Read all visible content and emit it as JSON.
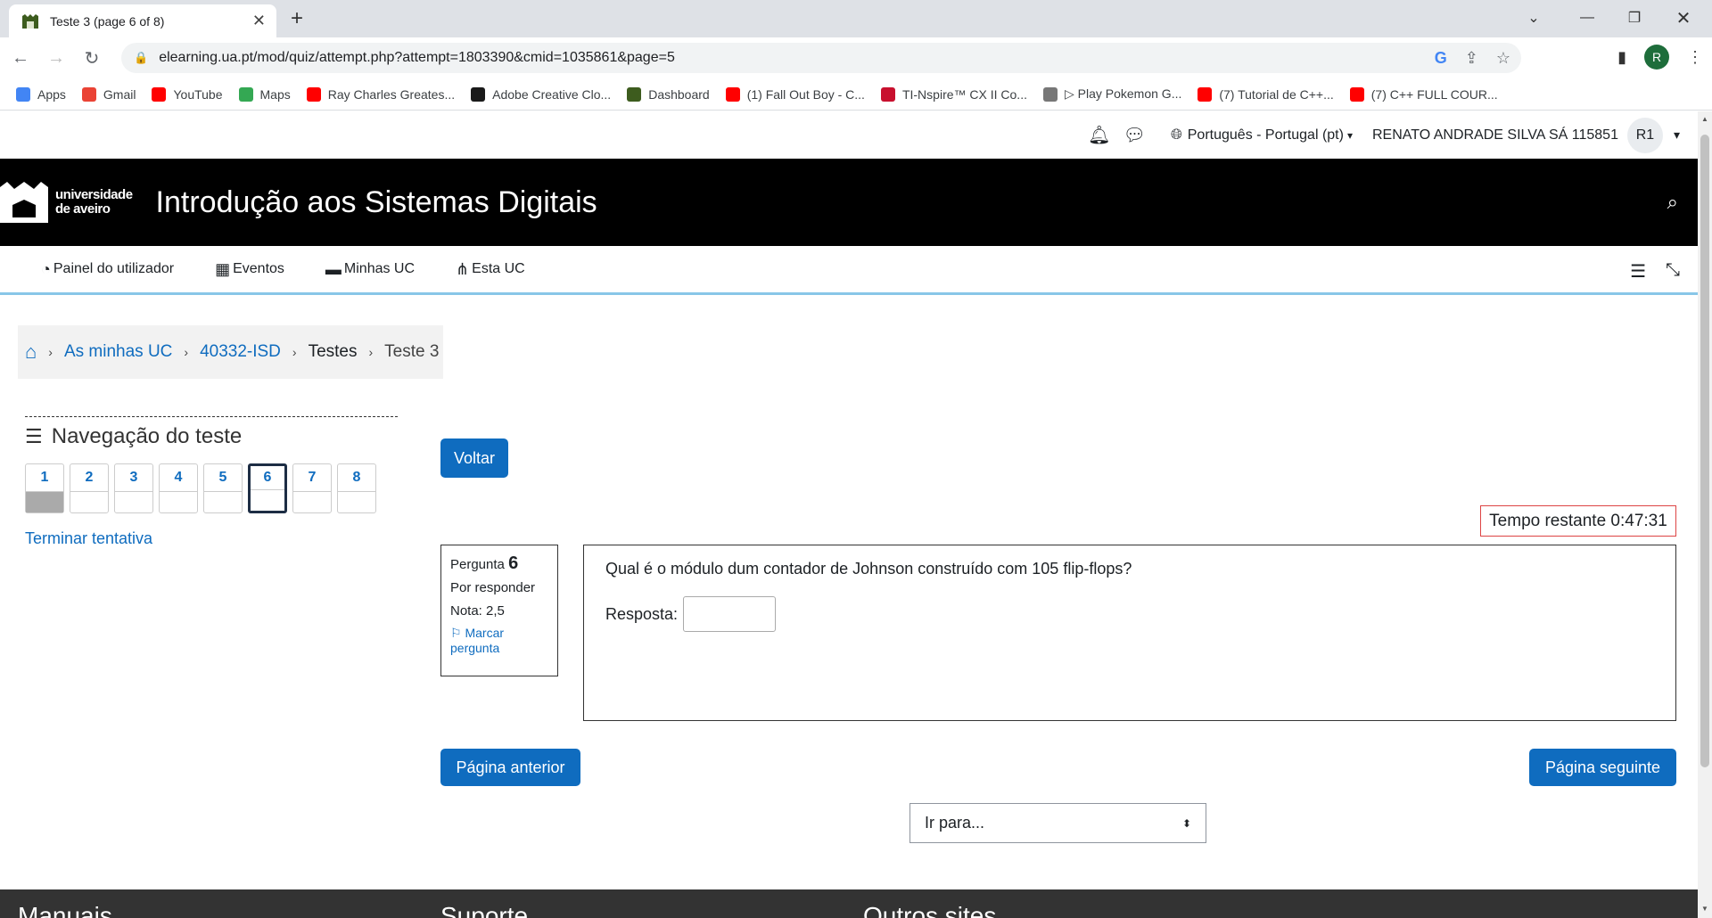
{
  "browser": {
    "tab_title": "Teste 3 (page 6 of 8)",
    "url": "elearning.ua.pt/mod/quiz/attempt.php?attempt=1803390&cmid=1035861&page=5",
    "profile_initial": "R",
    "bookmarks": [
      {
        "label": "Apps",
        "icon": "apps-grid-icon",
        "color": "#4285f4"
      },
      {
        "label": "Gmail",
        "icon": "gmail-icon",
        "color": "#ea4335"
      },
      {
        "label": "YouTube",
        "icon": "youtube-icon",
        "color": "#ff0000"
      },
      {
        "label": "Maps",
        "icon": "maps-icon",
        "color": "#34a853"
      },
      {
        "label": "Ray Charles Greates...",
        "icon": "youtube-icon",
        "color": "#ff0000"
      },
      {
        "label": "Adobe Creative Clo...",
        "icon": "adobe-icon",
        "color": "#1a1a1a"
      },
      {
        "label": "Dashboard",
        "icon": "ua-icon",
        "color": "#3d5c1e"
      },
      {
        "label": "(1) Fall Out Boy - C...",
        "icon": "youtube-icon",
        "color": "#ff0000"
      },
      {
        "label": "TI-Nspire™ CX II Co...",
        "icon": "ti-icon",
        "color": "#c8102e"
      },
      {
        "label": "▷ Play Pokemon G...",
        "icon": "gamepad-icon",
        "color": "#777777"
      },
      {
        "label": "(7) Tutorial de C++...",
        "icon": "youtube-icon",
        "color": "#ff0000"
      },
      {
        "label": "(7) C++ FULL COUR...",
        "icon": "youtube-icon",
        "color": "#ff0000"
      }
    ]
  },
  "header": {
    "language": "Português - Portugal (pt)",
    "user_name": "RENATO ANDRADE SILVA SÁ 115851",
    "user_initials": "R1"
  },
  "banner": {
    "logo_line1": "universidade",
    "logo_line2": "de aveiro",
    "course_title": "Introdução aos Sistemas Digitais"
  },
  "nav": {
    "items": [
      {
        "label": "Painel do utilizador",
        "icon": "dashboard-icon"
      },
      {
        "label": "Eventos",
        "icon": "calendar-icon"
      },
      {
        "label": "Minhas UC",
        "icon": "briefcase-icon"
      },
      {
        "label": "Esta UC",
        "icon": "sitemap-icon"
      }
    ]
  },
  "breadcrumb": {
    "items": [
      "As minhas UC",
      "40332-ISD",
      "Testes",
      "Teste 3"
    ]
  },
  "quiz_nav": {
    "heading": "Navegação do teste",
    "questions": [
      {
        "label": "1",
        "state": "answered"
      },
      {
        "label": "2",
        "state": "unanswered"
      },
      {
        "label": "3",
        "state": "unanswered"
      },
      {
        "label": "4",
        "state": "unanswered"
      },
      {
        "label": "5",
        "state": "unanswered"
      },
      {
        "label": "6",
        "state": "current"
      },
      {
        "label": "7",
        "state": "unanswered"
      },
      {
        "label": "8",
        "state": "unanswered"
      }
    ],
    "finish_label": "Terminar tentativa"
  },
  "main": {
    "back_label": "Voltar",
    "timer": "Tempo restante 0:47:31",
    "question": {
      "label": "Pergunta",
      "number": "6",
      "status": "Por responder",
      "grade": "Nota: 2,5",
      "flag_label": "Marcar pergunta",
      "text": "Qual é o módulo dum contador de Johnson construído com 105 flip-flops?",
      "answer_label": "Resposta:",
      "answer_value": ""
    },
    "prev_label": "Página anterior",
    "next_label": "Página seguinte",
    "goto_label": "Ir para..."
  },
  "footer": {
    "col1": "Manuais",
    "col2": "Suporte",
    "col3": "Outros sites"
  }
}
